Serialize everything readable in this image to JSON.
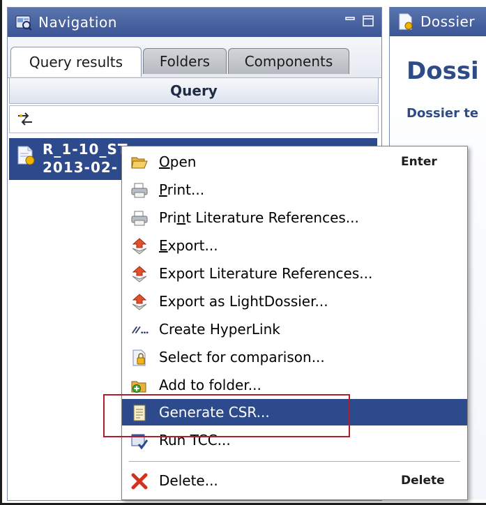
{
  "navigation": {
    "title": "Navigation",
    "tabs": [
      {
        "label": "Query results",
        "active": true
      },
      {
        "label": "Folders",
        "active": false
      },
      {
        "label": "Components",
        "active": false
      }
    ],
    "query_button": "Query",
    "results": [
      {
        "line1": "R_1-10_ST",
        "line2": "2013-02-",
        "icon": "document-icon"
      }
    ]
  },
  "dossier": {
    "tab_title": "Dossier",
    "heading": "Dossi",
    "subheading": "Dossier te"
  },
  "context_menu": {
    "items": [
      {
        "label": "Open",
        "mnemonic": "O",
        "shortcut": "Enter",
        "icon": "open-folder-icon"
      },
      {
        "label": "Print...",
        "mnemonic": "P",
        "icon": "printer-icon"
      },
      {
        "label": "Print Literature References...",
        "mnemonic": "n",
        "icon": "printer-icon"
      },
      {
        "label": "Export...",
        "mnemonic": "E",
        "icon": "export-icon"
      },
      {
        "label": "Export Literature References...",
        "icon": "export-icon"
      },
      {
        "label": "Export as LightDossier...",
        "icon": "export-icon"
      },
      {
        "label": "Create HyperLink",
        "icon": "hyperlink-icon"
      },
      {
        "label": "Select for comparison...",
        "icon": "compare-icon"
      },
      {
        "label": "Add to folder...",
        "icon": "add-folder-icon"
      },
      {
        "label": "Generate CSR...",
        "selected": true,
        "icon": "report-icon"
      },
      {
        "label": "Run TCC...",
        "icon": "run-tcc-icon"
      },
      {
        "label": "Delete...",
        "shortcut": "Delete",
        "icon": "delete-icon"
      }
    ]
  },
  "colors": {
    "title_bar": "#3b5596",
    "selection": "#2d4b8c",
    "highlight_box": "#b11d2b"
  }
}
